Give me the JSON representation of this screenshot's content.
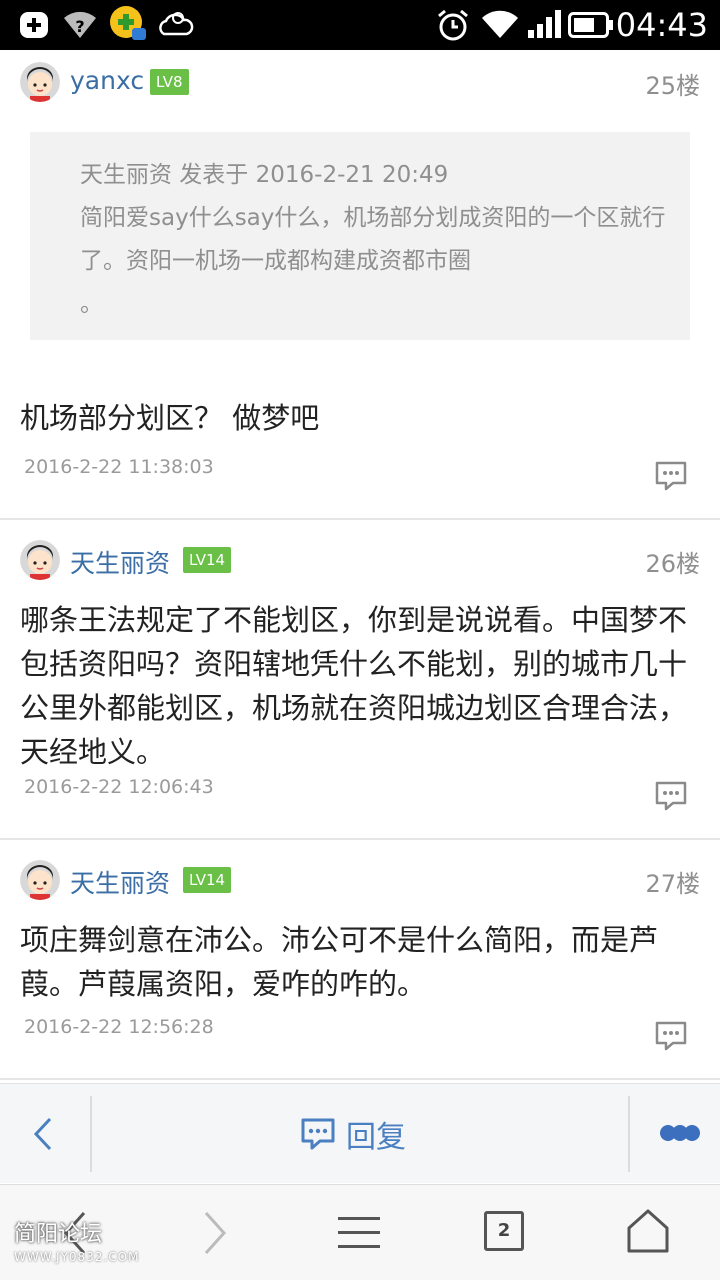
{
  "status_bar": {
    "time": "04:43",
    "left_icons": [
      "add-icon",
      "wifi-question-icon",
      "app-notification-icon",
      "weather-icon"
    ],
    "right_icons": [
      "alarm-icon",
      "wifi-icon",
      "signal-icon",
      "battery-icon"
    ]
  },
  "posts": [
    {
      "username": "yanxc",
      "level": "LV8",
      "floor": "25楼",
      "quote": {
        "header": "天生丽资 发表于 2016-2-21 20:49",
        "text": "简阳爱say什么say什么，机场部分划成资阳的一个区就行了。资阳一机场一成都构建成资都市圈",
        "tail": "。"
      },
      "body": "机场部分划区？ 做梦吧",
      "time": "2016-2-22 11:38:03"
    },
    {
      "username": "天生丽资",
      "level": "LV14",
      "floor": "26楼",
      "body": "哪条王法规定了不能划区，你到是说说看。中国梦不包括资阳吗？资阳辖地凭什么不能划，别的城市几十公里外都能划区，机场就在资阳城边划区合理合法，天经地义。",
      "time": "2016-2-22 12:06:43"
    },
    {
      "username": "天生丽资",
      "level": "LV14",
      "floor": "27楼",
      "body": "项庄舞剑意在沛公。沛公可不是什么简阳，而是芦葭。芦葭属资阳，爱咋的咋的。",
      "time": "2016-2-22 12:56:28"
    }
  ],
  "reply_bar": {
    "reply_label": "回复"
  },
  "bottom_nav": {
    "tab_count": "2",
    "watermark": "简阳论坛",
    "watermark_url": "WWW.JY0832.COM"
  },
  "colors": {
    "username": "#3a6ea5",
    "level_badge": "#6abf47",
    "reply_accent": "#4a7fc1"
  }
}
